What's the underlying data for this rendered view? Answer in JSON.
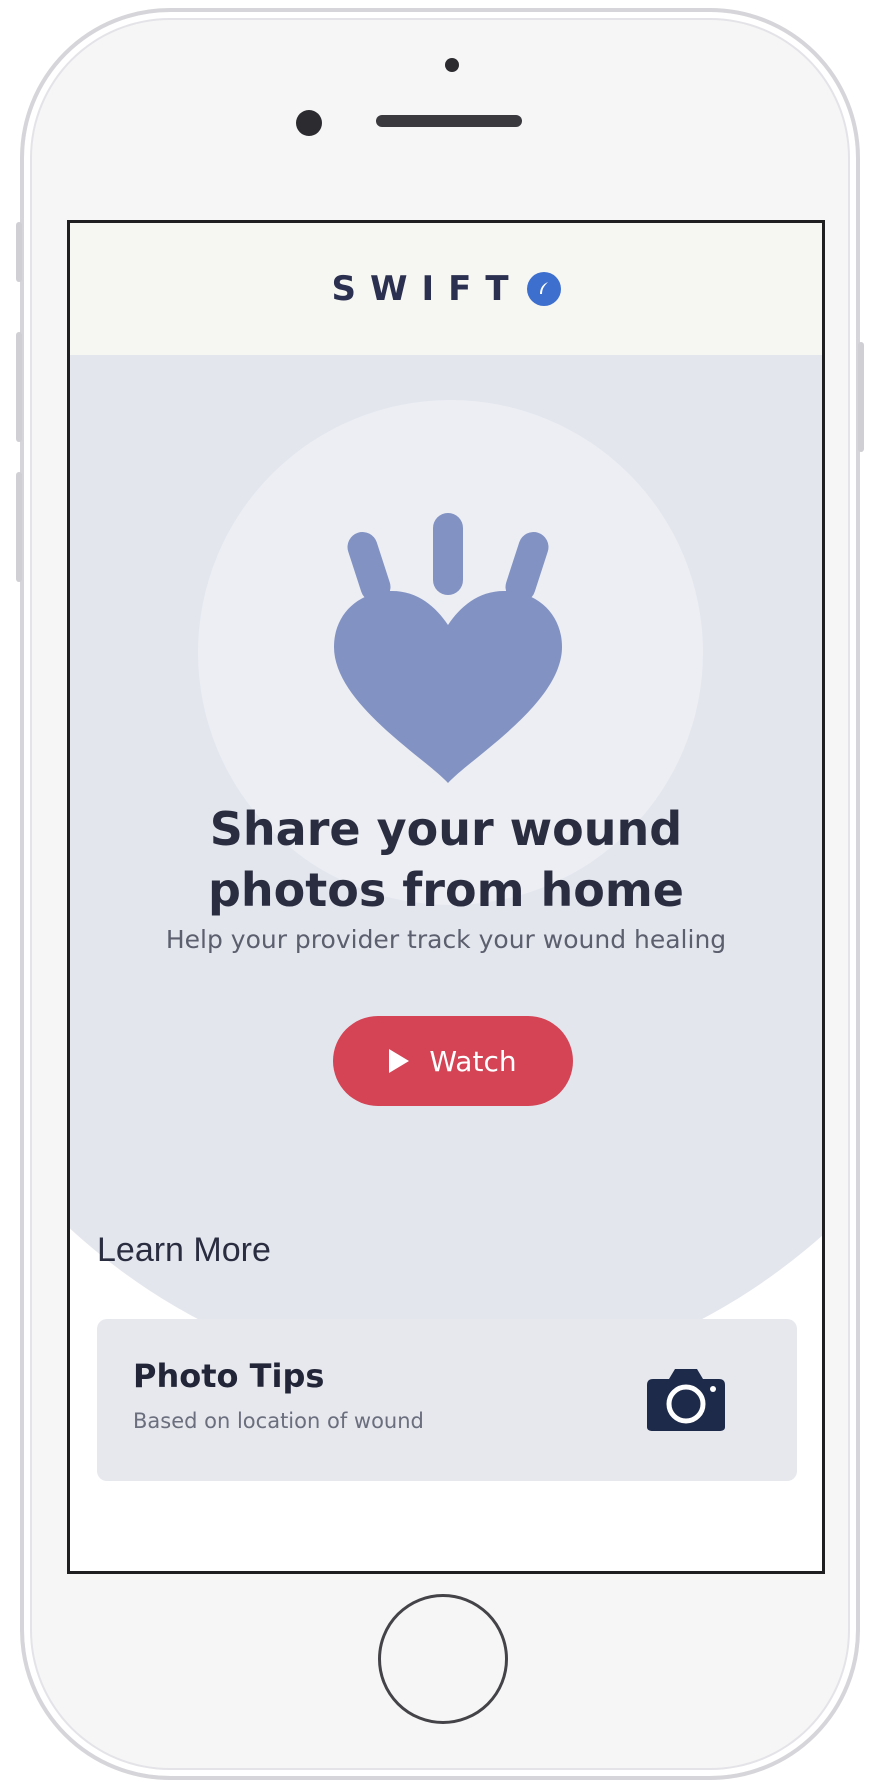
{
  "app": {
    "brand": "SWIFT",
    "brand_icon": "swift-feather-logo-icon",
    "accent_color": "#d44455",
    "brand_color": "#3d6fce"
  },
  "hero": {
    "icon": "heart-hand-icon",
    "headline": "Share your wound photos from home",
    "subtitle": "Help your provider track your wound healing",
    "watch_button": {
      "icon": "play-icon",
      "label": "Watch"
    }
  },
  "learn_more": {
    "title": "Learn More",
    "cards": [
      {
        "title": "Photo Tips",
        "subtitle": "Based on location of wound",
        "icon": "camera-icon"
      }
    ]
  }
}
